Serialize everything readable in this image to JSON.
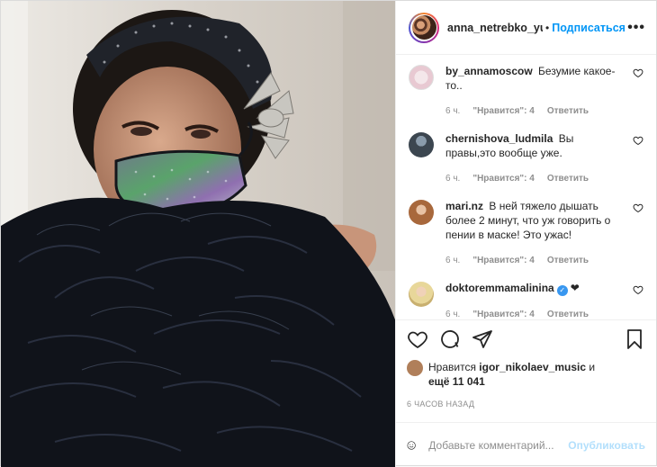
{
  "post": {
    "username": "anna_netrebko_yus",
    "follow_label": "Подписаться",
    "more_label": "•••"
  },
  "comments": [
    {
      "user": "by_annamoscow",
      "text": "Безумие какое-то..",
      "time": "6 ч.",
      "likes": "\"Нравится\": 4",
      "reply": "Ответить"
    },
    {
      "user": "chernishova_ludmila",
      "text": "Вы правы,это вообще уже.",
      "time": "6 ч.",
      "likes": "\"Нравится\": 4",
      "reply": "Ответить"
    },
    {
      "user": "mari.nz",
      "text": "В ней тяжело дышать более 2 минут, что уж говорить о пении в маске! Это ужас!",
      "time": "6 ч.",
      "likes": "\"Нравится\": 4",
      "reply": "Ответить"
    },
    {
      "user": "doktoremmamalinina",
      "text": "❤",
      "time": "6 ч.",
      "likes": "\"Нравится\": 4",
      "reply": "Ответить"
    }
  ],
  "likes": {
    "prefix": "Нравится",
    "user": "igor_nikolaev_music",
    "middle": " и",
    "others": "ещё 11 041"
  },
  "timestamp": "6 часов назад",
  "comment_box": {
    "placeholder": "Добавьте комментарий...",
    "publish_label": "Опубликовать"
  },
  "colors": {
    "accent": "#0095f6",
    "publish_disabled": "#b2dffc",
    "meta": "#8e8e8e"
  }
}
